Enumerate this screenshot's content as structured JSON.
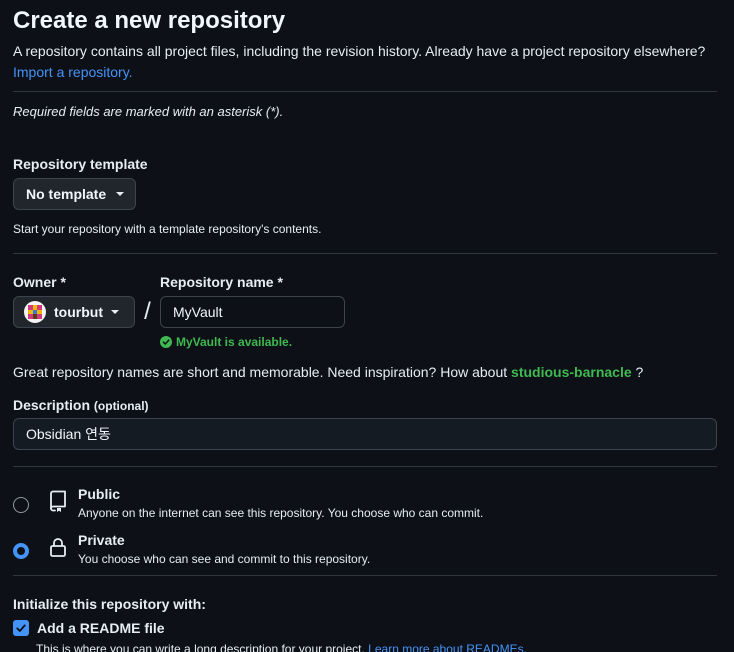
{
  "header": {
    "title": "Create a new repository",
    "subtitle": "A repository contains all project files, including the revision history. Already have a project repository elsewhere?",
    "import_link": "Import a repository."
  },
  "required_note": "Required fields are marked with an asterisk (*).",
  "template": {
    "label": "Repository template",
    "selected": "No template",
    "hint": "Start your repository with a template repository's contents."
  },
  "owner": {
    "label": "Owner *",
    "selected": "tourbut"
  },
  "slash": "/",
  "repo_name": {
    "label": "Repository name *",
    "value": "MyVault",
    "availability": "MyVault is available."
  },
  "inspiration": {
    "text": "Great repository names are short and memorable. Need inspiration? How about",
    "suggestion": "studious-barnacle",
    "suffix": "?"
  },
  "description": {
    "label": "Description",
    "optional": "(optional)",
    "value": "Obsidian 연동"
  },
  "visibility": {
    "public": {
      "title": "Public",
      "desc": "Anyone on the internet can see this repository. You choose who can commit.",
      "checked": false
    },
    "private": {
      "title": "Private",
      "desc": "You choose who can see and commit to this repository.",
      "checked": true
    }
  },
  "initialize": {
    "title": "Initialize this repository with:",
    "readme_label": "Add a README file",
    "readme_checked": true,
    "readme_desc": "This is where you can write a long description for your project.",
    "readme_link": "Learn more about READMEs."
  },
  "colors": {
    "background": "#0d1117",
    "accent": "#4493f8",
    "success": "#3fb950",
    "border": "#30363d"
  }
}
